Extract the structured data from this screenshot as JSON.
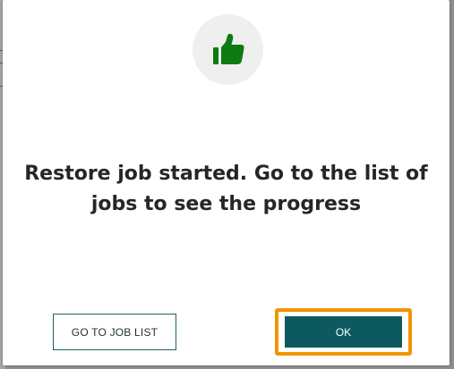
{
  "dialog": {
    "icon": "thumbs-up-icon",
    "message": "Restore job started. Go to the list of jobs to see the progress",
    "buttons": {
      "go_to_job_list": "GO TO JOB LIST",
      "ok": "OK"
    }
  },
  "colors": {
    "icon_green": "#0e7a12",
    "primary_button": "#0c5a5f",
    "focus_outline": "#f29400"
  }
}
